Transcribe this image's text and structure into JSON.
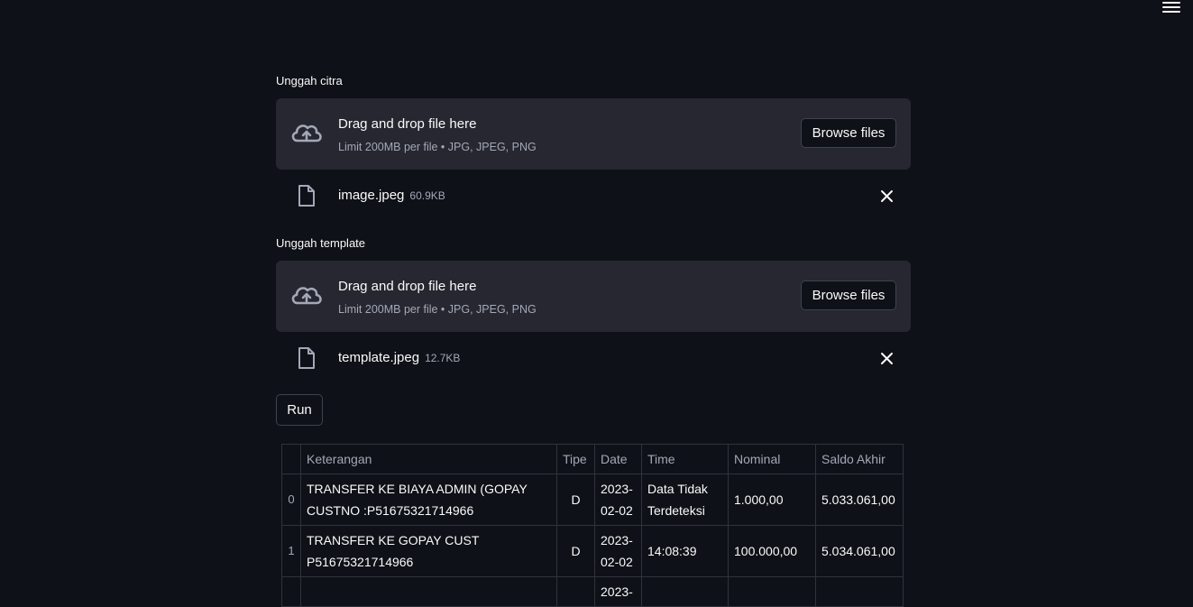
{
  "uploaders": [
    {
      "label": "Unggah citra",
      "drop_text": "Drag and drop file here",
      "limit_text": "Limit 200MB per file • JPG, JPEG, PNG",
      "browse_label": "Browse files",
      "file": {
        "name": "image.jpeg",
        "size": "60.9KB"
      }
    },
    {
      "label": "Unggah template",
      "drop_text": "Drag and drop file here",
      "limit_text": "Limit 200MB per file • JPG, JPEG, PNG",
      "browse_label": "Browse files",
      "file": {
        "name": "template.jpeg",
        "size": "12.7KB"
      }
    }
  ],
  "run_label": "Run",
  "table": {
    "headers": [
      "",
      "Keterangan",
      "Tipe",
      "Date",
      "Time",
      "Nominal",
      "Saldo Akhir"
    ],
    "rows": [
      {
        "index": "0",
        "keterangan_1": "TRANSFER KE BIAYA ADMIN (GOPAY",
        "keterangan_2": "CUSTNO :P51675321714966",
        "tipe": "D",
        "date_1": "2023-",
        "date_2": "02-02",
        "time_1": "Data Tidak",
        "time_2": "Terdeteksi",
        "nominal": "1.000,00",
        "saldo": "5.033.061,00"
      },
      {
        "index": "1",
        "keterangan_1": "TRANSFER KE GOPAY CUST",
        "keterangan_2": "P51675321714966",
        "tipe": "D",
        "date_1": "2023-",
        "date_2": "02-02",
        "time_1": "14:08:39",
        "time_2": "",
        "nominal": "100.000,00",
        "saldo": "5.034.061,00"
      },
      {
        "index": "",
        "keterangan_1": "",
        "keterangan_2": "",
        "tipe": "",
        "date_1": "2023-",
        "date_2": "",
        "time_1": "",
        "time_2": "",
        "nominal": "",
        "saldo": ""
      }
    ]
  },
  "colors": {
    "background": "#0e1117",
    "dropzone": "#262730",
    "text": "#fafafa",
    "muted": "#a3a8b8",
    "border": "#30333d"
  },
  "icons": [
    "hamburger-menu-icon",
    "cloud-upload-icon",
    "file-icon",
    "close-icon"
  ]
}
